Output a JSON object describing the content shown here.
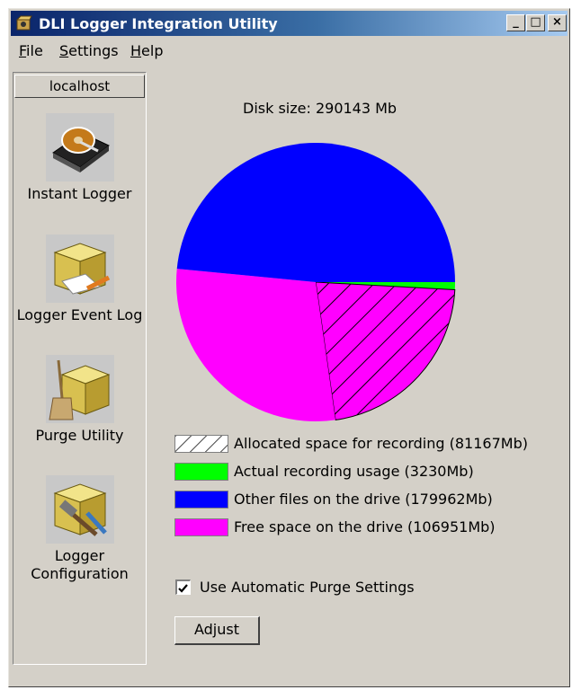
{
  "window": {
    "title": "DLI Logger Integration Utility"
  },
  "title_buttons": {
    "minimize": "_",
    "maximize": "□",
    "close": "×"
  },
  "menu": [
    {
      "label": "File",
      "accel": "F",
      "rest": "ile"
    },
    {
      "label": "Settings",
      "accel": "S",
      "rest": "ettings"
    },
    {
      "label": "Help",
      "accel": "H",
      "rest": "elp"
    }
  ],
  "sidebar": {
    "host": "localhost",
    "tools": [
      {
        "label": "Instant Logger",
        "icon": "hard-drive-icon"
      },
      {
        "label": "Logger Event Log",
        "icon": "event-log-box-icon"
      },
      {
        "label": "Purge Utility",
        "icon": "broom-box-icon"
      },
      {
        "label_line1": "Logger",
        "label_line2": "Configuration",
        "icon": "tools-box-icon"
      }
    ]
  },
  "disk": {
    "label": "Disk size: 290143 Mb"
  },
  "chart_data": {
    "type": "pie",
    "title": "Disk size: 290143 Mb",
    "slices": [
      {
        "label": "Actual recording usage (3230Mb)",
        "value": 3230,
        "color": "#00ff00"
      },
      {
        "label": "Allocated space for recording (81167Mb)",
        "value": 81167,
        "color": "#ff00ff",
        "pattern": "hatched"
      },
      {
        "label": "Free space on the drive (106951Mb)",
        "value": 106951,
        "color": "#ff00ff"
      },
      {
        "label": "Other files on the drive (179962Mb)",
        "value": 179962,
        "color": "#0000ff"
      }
    ],
    "legend": [
      {
        "text": "Allocated space for recording (81167Mb)",
        "swatch": "hatched"
      },
      {
        "text": "Actual recording usage (3230Mb)",
        "swatch": "#00ff00"
      },
      {
        "text": "Other files on the drive (179962Mb)",
        "swatch": "#0000ff"
      },
      {
        "text": "Free space on the drive (106951Mb)",
        "swatch": "#ff00ff"
      }
    ]
  },
  "settings": {
    "auto_purge_label": "Use Automatic Purge Settings",
    "auto_purge_checked": true,
    "adjust_label": "Adjust"
  }
}
